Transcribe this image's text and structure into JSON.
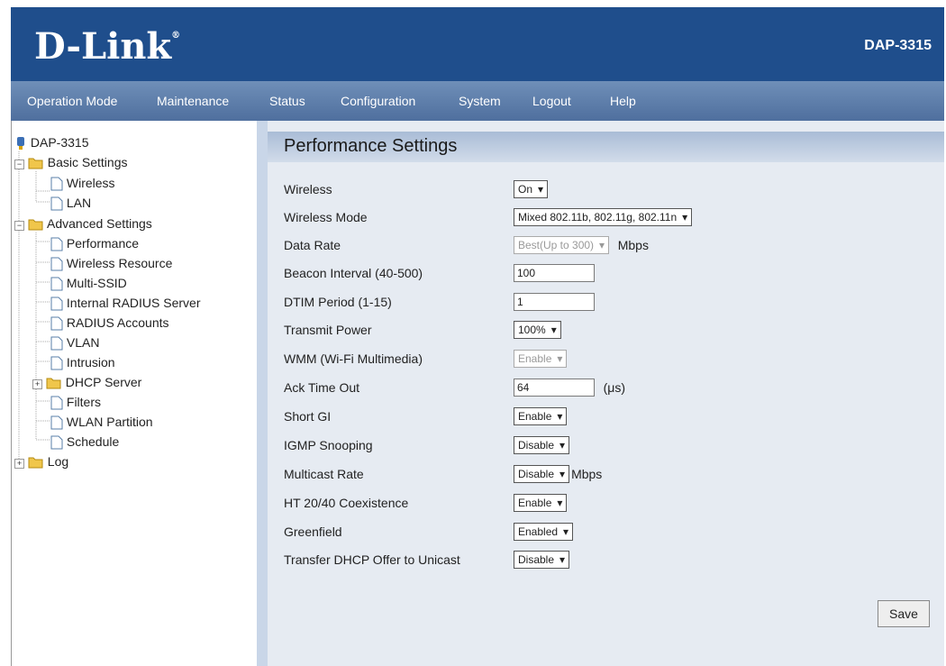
{
  "header": {
    "logo_text": "D-Link",
    "model": "DAP-3315"
  },
  "menu": {
    "items": [
      "Operation Mode",
      "Maintenance",
      "Status",
      "Configuration",
      "System",
      "Logout",
      "Help"
    ]
  },
  "tree": {
    "root": "DAP-3315",
    "basic_settings": "Basic Settings",
    "wireless": "Wireless",
    "lan": "LAN",
    "advanced_settings": "Advanced Settings",
    "performance": "Performance",
    "wireless_resource": "Wireless Resource",
    "multi_ssid": "Multi-SSID",
    "internal_radius": "Internal RADIUS Server",
    "radius_accounts": "RADIUS Accounts",
    "vlan": "VLAN",
    "intrusion": "Intrusion",
    "dhcp_server": "DHCP Server",
    "filters": "Filters",
    "wlan_partition": "WLAN Partition",
    "schedule": "Schedule",
    "log": "Log"
  },
  "page": {
    "title": "Performance Settings"
  },
  "settings": {
    "wireless": {
      "label": "Wireless",
      "value": "On"
    },
    "wireless_mode": {
      "label": "Wireless Mode",
      "value": "Mixed 802.11b, 802.11g, 802.11n"
    },
    "data_rate": {
      "label": "Data Rate",
      "value": "Best(Up to 300)",
      "unit": "Mbps"
    },
    "beacon_interval": {
      "label": "Beacon Interval (40-500)",
      "value": "100"
    },
    "dtim_period": {
      "label": "DTIM Period (1-15)",
      "value": "1"
    },
    "transmit_power": {
      "label": "Transmit Power",
      "value": "100%"
    },
    "wmm": {
      "label": "WMM (Wi-Fi Multimedia)",
      "value": "Enable"
    },
    "ack_timeout": {
      "label": "Ack Time Out",
      "value": "64",
      "unit": "(μs)"
    },
    "short_gi": {
      "label": "Short GI",
      "value": "Enable"
    },
    "igmp_snooping": {
      "label": "IGMP Snooping",
      "value": "Disable"
    },
    "multicast_rate": {
      "label": "Multicast Rate",
      "value": "Disable",
      "unit": "Mbps"
    },
    "ht2040": {
      "label": "HT 20/40 Coexistence",
      "value": "Enable"
    },
    "greenfield": {
      "label": "Greenfield",
      "value": "Enabled"
    },
    "dhcp_unicast": {
      "label": "Transfer DHCP Offer to Unicast",
      "value": "Disable"
    }
  },
  "buttons": {
    "save": "Save"
  },
  "colors": {
    "header_bg": "#1f4e8c",
    "menu_bg": "#5b7aa8",
    "content_bg": "#e6ebf2",
    "title_bar": "#b8c8de"
  }
}
